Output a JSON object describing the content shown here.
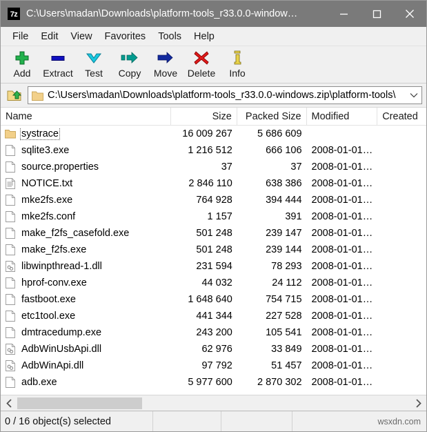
{
  "window": {
    "app_icon": "7z",
    "title": "C:\\Users\\madan\\Downloads\\platform-tools_r33.0.0-window…",
    "minimize_label": "Minimize",
    "maximize_label": "Maximize",
    "close_label": "Close",
    "titlebar_color": "#7a7a7a"
  },
  "menubar": {
    "items": [
      {
        "label": "File"
      },
      {
        "label": "Edit"
      },
      {
        "label": "View"
      },
      {
        "label": "Favorites"
      },
      {
        "label": "Tools"
      },
      {
        "label": "Help"
      }
    ]
  },
  "toolbar": {
    "buttons": [
      {
        "label": "Add",
        "icon": "plus-icon",
        "color": "#22b14c"
      },
      {
        "label": "Extract",
        "icon": "minus-bar-icon",
        "color": "#1010c0"
      },
      {
        "label": "Test",
        "icon": "chevron-down-icon",
        "color": "#18c8e0"
      },
      {
        "label": "Copy",
        "icon": "copy-arrow-icon",
        "color": "#009b8f"
      },
      {
        "label": "Move",
        "icon": "move-arrow-icon",
        "color": "#122a9e"
      },
      {
        "label": "Delete",
        "icon": "x-mark-icon",
        "color": "#e01b1b"
      },
      {
        "label": "Info",
        "icon": "info-icon",
        "color": "#e8d24a"
      }
    ]
  },
  "address_bar": {
    "up_button_icon": "folder-up-icon",
    "folder_icon": "folder-icon",
    "path": "C:\\Users\\madan\\Downloads\\platform-tools_r33.0.0-windows.zip\\platform-tools\\",
    "dropdown_icon": "chevron-down-icon"
  },
  "file_list": {
    "columns": [
      {
        "label": "Name"
      },
      {
        "label": "Size"
      },
      {
        "label": "Packed Size"
      },
      {
        "label": "Modified"
      },
      {
        "label": "Created"
      }
    ],
    "rows": [
      {
        "icon": "folder-icon",
        "name": "systrace",
        "size": "16 009 267",
        "packed": "5 686 609",
        "modified": "",
        "created": "",
        "focused": true
      },
      {
        "icon": "file-icon",
        "name": "sqlite3.exe",
        "size": "1 216 512",
        "packed": "666 106",
        "modified": "2008-01-01…",
        "created": ""
      },
      {
        "icon": "file-icon",
        "name": "source.properties",
        "size": "37",
        "packed": "37",
        "modified": "2008-01-01…",
        "created": ""
      },
      {
        "icon": "text-file-icon",
        "name": "NOTICE.txt",
        "size": "2 846 110",
        "packed": "638 386",
        "modified": "2008-01-01…",
        "created": ""
      },
      {
        "icon": "file-icon",
        "name": "mke2fs.exe",
        "size": "764 928",
        "packed": "394 444",
        "modified": "2008-01-01…",
        "created": ""
      },
      {
        "icon": "file-icon",
        "name": "mke2fs.conf",
        "size": "1 157",
        "packed": "391",
        "modified": "2008-01-01…",
        "created": ""
      },
      {
        "icon": "file-icon",
        "name": "make_f2fs_casefold.exe",
        "size": "501 248",
        "packed": "239 147",
        "modified": "2008-01-01…",
        "created": ""
      },
      {
        "icon": "file-icon",
        "name": "make_f2fs.exe",
        "size": "501 248",
        "packed": "239 144",
        "modified": "2008-01-01…",
        "created": ""
      },
      {
        "icon": "dll-file-icon",
        "name": "libwinpthread-1.dll",
        "size": "231 594",
        "packed": "78 293",
        "modified": "2008-01-01…",
        "created": ""
      },
      {
        "icon": "file-icon",
        "name": "hprof-conv.exe",
        "size": "44 032",
        "packed": "24 112",
        "modified": "2008-01-01…",
        "created": ""
      },
      {
        "icon": "file-icon",
        "name": "fastboot.exe",
        "size": "1 648 640",
        "packed": "754 715",
        "modified": "2008-01-01…",
        "created": ""
      },
      {
        "icon": "file-icon",
        "name": "etc1tool.exe",
        "size": "441 344",
        "packed": "227 528",
        "modified": "2008-01-01…",
        "created": ""
      },
      {
        "icon": "file-icon",
        "name": "dmtracedump.exe",
        "size": "243 200",
        "packed": "105 541",
        "modified": "2008-01-01…",
        "created": ""
      },
      {
        "icon": "dll-file-icon",
        "name": "AdbWinUsbApi.dll",
        "size": "62 976",
        "packed": "33 849",
        "modified": "2008-01-01…",
        "created": ""
      },
      {
        "icon": "dll-file-icon",
        "name": "AdbWinApi.dll",
        "size": "97 792",
        "packed": "51 457",
        "modified": "2008-01-01…",
        "created": ""
      },
      {
        "icon": "file-icon",
        "name": "adb.exe",
        "size": "5 977 600",
        "packed": "2 870 302",
        "modified": "2008-01-01…",
        "created": ""
      }
    ]
  },
  "scrollbar": {
    "left_arrow_icon": "chevron-left-icon",
    "right_arrow_icon": "chevron-right-icon"
  },
  "statusbar": {
    "selection": "0 / 16 object(s) selected",
    "panel2": "",
    "panel3": "",
    "watermark": "wsxdn.com"
  }
}
